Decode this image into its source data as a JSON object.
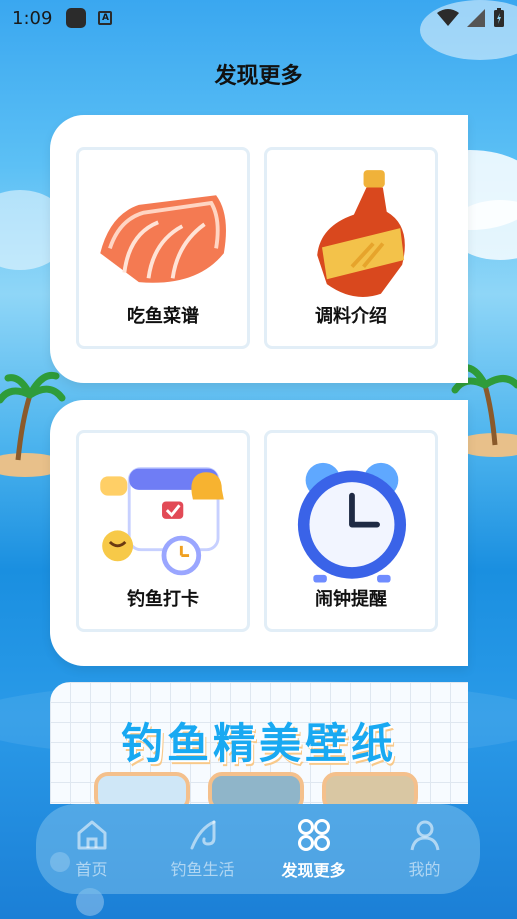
{
  "status_bar": {
    "time": "1:09",
    "notification_icon_letter": "A"
  },
  "page": {
    "title": "发现更多"
  },
  "cards": [
    {
      "tiles": [
        {
          "label": "吃鱼菜谱",
          "icon": "salmon-icon"
        },
        {
          "label": "调料介绍",
          "icon": "sauce-bottle-icon"
        }
      ]
    },
    {
      "tiles": [
        {
          "label": "钓鱼打卡",
          "icon": "calendar-checkin-icon"
        },
        {
          "label": "闹钟提醒",
          "icon": "alarm-clock-icon"
        }
      ]
    }
  ],
  "banner": {
    "title": "钓鱼精美壁纸"
  },
  "bottom_nav": {
    "items": [
      {
        "label": "首页",
        "icon": "home-icon",
        "active": false
      },
      {
        "label": "钓鱼生活",
        "icon": "fishing-hook-icon",
        "active": false
      },
      {
        "label": "发现更多",
        "icon": "discover-grid-icon",
        "active": true
      },
      {
        "label": "我的",
        "icon": "profile-icon",
        "active": false
      }
    ]
  },
  "colors": {
    "accent": "#19a9f2",
    "banner_shadow": "#f8c98a",
    "tile_border": "#e2eef7"
  }
}
